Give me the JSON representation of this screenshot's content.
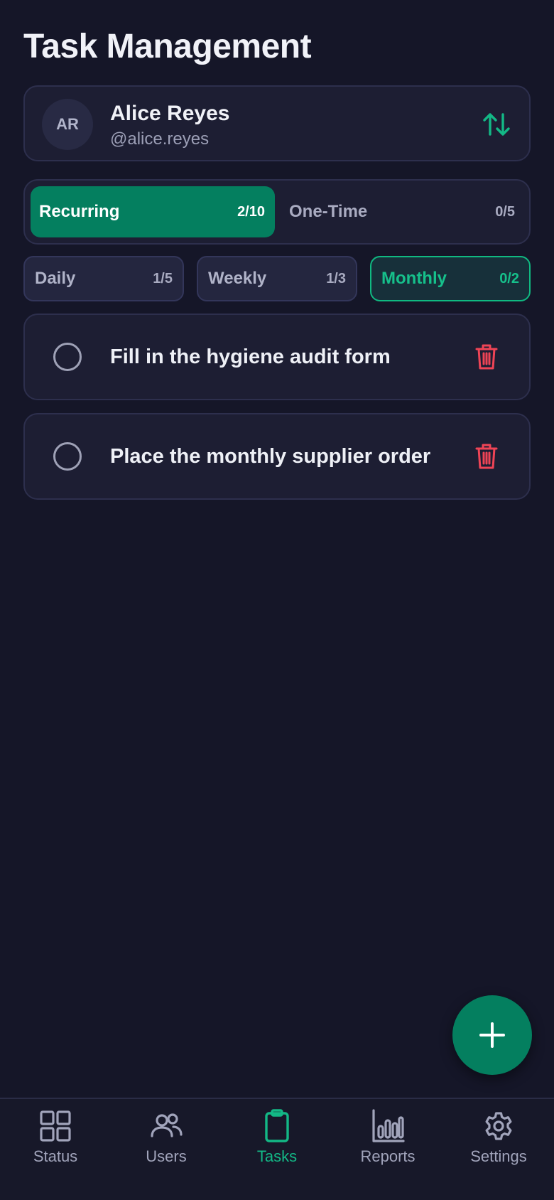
{
  "page_title": "Task Management",
  "user": {
    "initials": "AR",
    "name": "Alice Reyes",
    "handle": "@alice.reyes"
  },
  "type_tabs": [
    {
      "label": "Recurring",
      "count": "2/10",
      "active": true
    },
    {
      "label": "One-Time",
      "count": "0/5",
      "active": false
    }
  ],
  "frequency_tabs": [
    {
      "label": "Daily",
      "count": "1/5",
      "active": false
    },
    {
      "label": "Weekly",
      "count": "1/3",
      "active": false
    },
    {
      "label": "Monthly",
      "count": "0/2",
      "active": true
    }
  ],
  "tasks": [
    {
      "title": "Fill in the hygiene audit form",
      "done": false
    },
    {
      "title": "Place the monthly supplier order",
      "done": false
    }
  ],
  "bottom_nav": [
    {
      "label": "Status",
      "icon": "grid-icon",
      "active": false
    },
    {
      "label": "Users",
      "icon": "users-icon",
      "active": false
    },
    {
      "label": "Tasks",
      "icon": "clipboard-icon",
      "active": true
    },
    {
      "label": "Reports",
      "icon": "bar-chart-icon",
      "active": false
    },
    {
      "label": "Settings",
      "icon": "gear-icon",
      "active": false
    }
  ],
  "colors": {
    "background": "#151628",
    "card": "#1d1e33",
    "accent": "#047f5f",
    "accent_text": "#16c08b",
    "danger": "#ef4456"
  }
}
